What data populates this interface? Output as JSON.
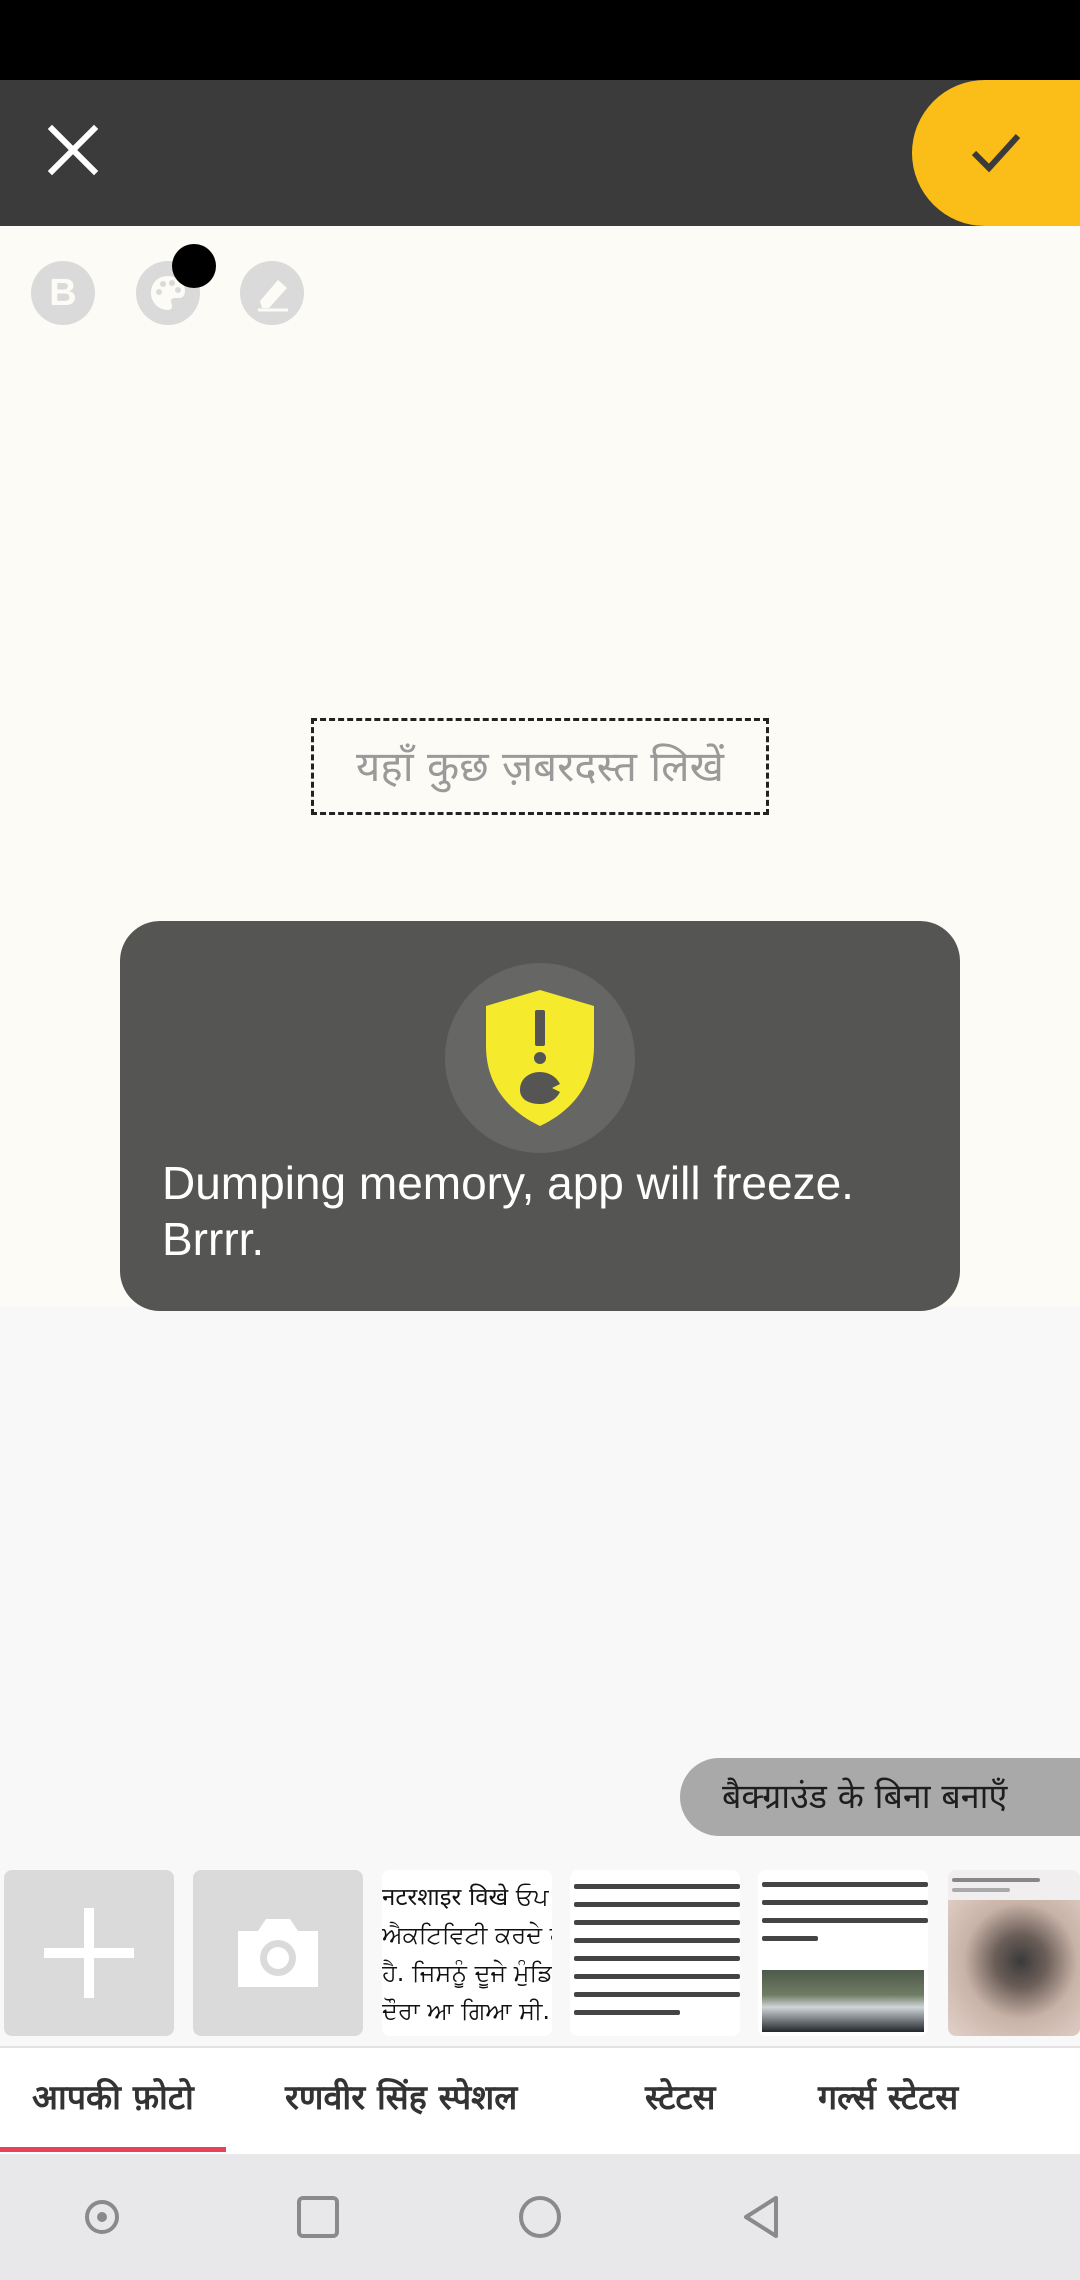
{
  "editor": {
    "placeholder_text": "यहाँ कुछ ज़बरदस्त लिखें",
    "bold_label": "B",
    "selected_color": "#000000",
    "confirm_color": "#fbbd17"
  },
  "toast": {
    "message": "Dumping memory, app will freeze. Brrrr."
  },
  "actions": {
    "no_background_label": "बैक्ग्राउंड के बिना बनाएँ"
  },
  "thumbnails": {
    "t1_lines": [
      "नटरशाइर विखे ਓਪ",
      "ਐਕਟਿਵਿਟੀ ਕਰਦੇ ਹੋ",
      "ਹੈ. ਜਿਸਨੂੰ ਦੂਜੇ ਮੁੰਡਿਆਂ",
      "ਦੌਰਾ ਆ ਗਿਆ ਸੀ."
    ]
  },
  "tabs": [
    {
      "label": "आपकी फ़ोटो",
      "active": true
    },
    {
      "label": "रणवीर सिंह स्पेशल",
      "active": false
    },
    {
      "label": "स्टेटस",
      "active": false
    },
    {
      "label": "गर्ल्स स्टेटस",
      "active": false
    }
  ]
}
